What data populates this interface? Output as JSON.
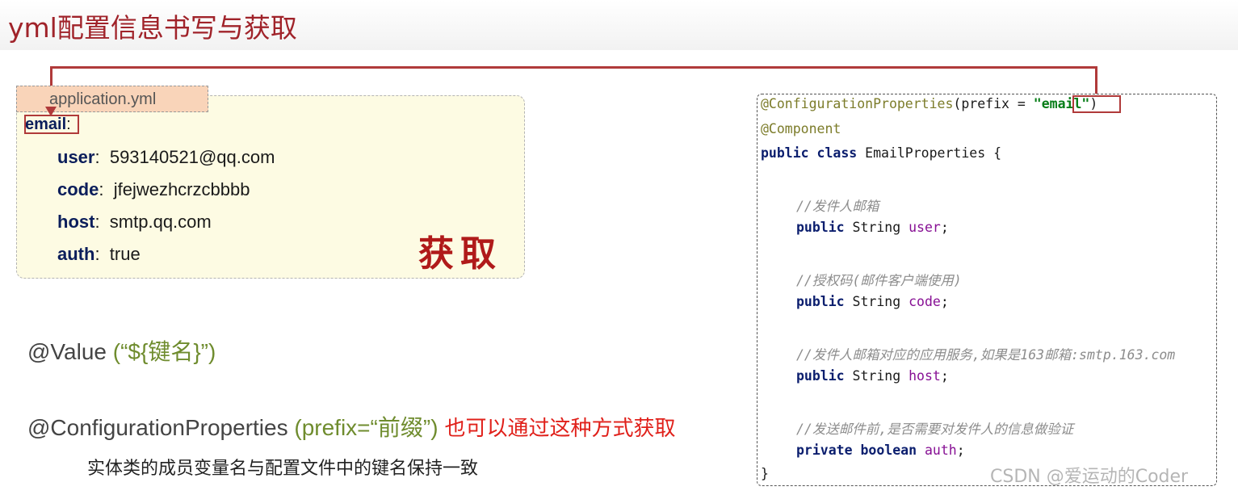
{
  "title": "yml配置信息书写与获取",
  "yml": {
    "filename": "application.yml",
    "root_key": "email",
    "root_colon": ":",
    "entries": [
      {
        "key": "user",
        "value": "593140521@qq.com"
      },
      {
        "key": "code",
        "value": "jfejwezhcrzcbbbb"
      },
      {
        "key": "host",
        "value": "smtp.qq.com"
      },
      {
        "key": "auth",
        "value": "true"
      }
    ],
    "stamp": "获取"
  },
  "usage": {
    "value_anno": "@Value",
    "value_arg": " (“${键名}”)",
    "cp_anno": "@ConfigurationProperties",
    "cp_paren_open": " (prefix=",
    "cp_arg": "“前缀”",
    "cp_paren_close": ")",
    "cp_note": "也可以通过这种方式获取",
    "sub_note": "实体类的成员变量名与配置文件中的键名保持一致"
  },
  "code": {
    "l1_anno": "@ConfigurationProperties",
    "l1_mid": "(prefix = ",
    "l1_q1": "\"",
    "l1_str": "email",
    "l1_q2": "\"",
    "l1_end": ")",
    "l2": "@Component",
    "l3_kw": "public class ",
    "l3_rest": "EmailProperties {",
    "c1": "//发件人邮箱",
    "f1_kw": "public ",
    "f1_type": "String ",
    "f1_name": "user",
    "c2": "//授权码(邮件客户端使用)",
    "f2_kw": "public ",
    "f2_type": "String ",
    "f2_name": "code",
    "c3": "//发件人邮箱对应的应用服务,如果是163邮箱:smtp.163.com",
    "f3_kw": "public ",
    "f3_type": "String ",
    "f3_name": "host",
    "c4": "//发送邮件前,是否需要对发件人的信息做验证",
    "f4_kw": "private boolean ",
    "f4_name": "auth",
    "semi": ";",
    "close": "}"
  },
  "watermark": "CSDN @爱运动的Coder",
  "colors": {
    "title": "#a0232a",
    "highlight_border": "#b03a3a",
    "olive": "#6f8c2e",
    "note_red": "#e0201a"
  }
}
